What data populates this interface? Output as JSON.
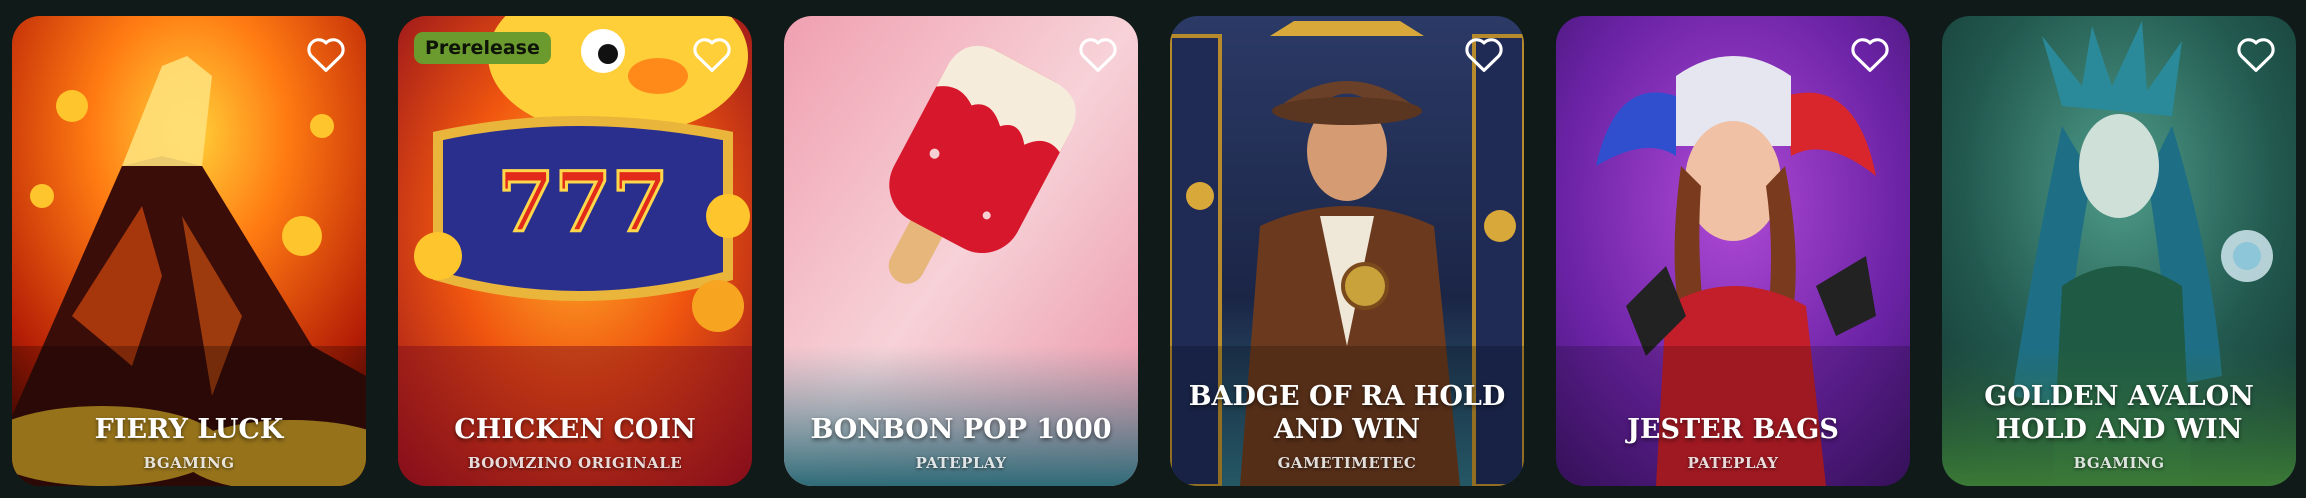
{
  "games": [
    {
      "title": "FIERY LUCK",
      "provider": "BGAMING",
      "badge": ""
    },
    {
      "title": "CHICKEN COIN",
      "provider": "BOOMZINO ORIGINALE",
      "badge": "Prerelease"
    },
    {
      "title": "BONBON POP 1000",
      "provider": "PATEPLAY",
      "badge": ""
    },
    {
      "title": "BADGE OF RA HOLD AND WIN",
      "provider": "GAMETIMETEC",
      "badge": ""
    },
    {
      "title": "JESTER BAGS",
      "provider": "PATEPLAY",
      "badge": ""
    },
    {
      "title": "GOLDEN AVALON HOLD AND WIN",
      "provider": "BGAMING",
      "badge": ""
    }
  ],
  "icons": {
    "favorite": "heart-outline-icon"
  },
  "colors": {
    "background": "#0f1a19",
    "badge": "#6b9a2e"
  }
}
